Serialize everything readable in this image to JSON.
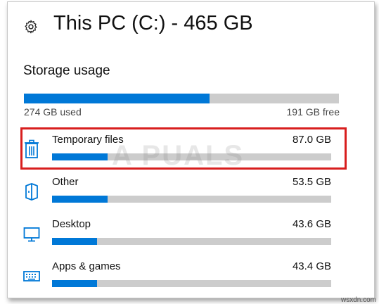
{
  "header": {
    "icon": "gear-icon",
    "title": "This PC (C:) - 465 GB"
  },
  "storage": {
    "section_title": "Storage usage",
    "used_text": "274 GB used",
    "free_text": "191 GB free",
    "used_fraction": 0.589
  },
  "items": [
    {
      "icon": "trash-icon",
      "label": "Temporary files",
      "size": "87.0 GB",
      "fill_fraction": 0.2
    },
    {
      "icon": "folder-icon",
      "label": "Other",
      "size": "53.5 GB",
      "fill_fraction": 0.2
    },
    {
      "icon": "monitor-icon",
      "label": "Desktop",
      "size": "43.6 GB",
      "fill_fraction": 0.16
    },
    {
      "icon": "keyboard-icon",
      "label": "Apps & games",
      "size": "43.4 GB",
      "fill_fraction": 0.16
    }
  ],
  "colors": {
    "accent": "#0078d7",
    "track": "#cccccc",
    "highlight": "#d81e1e"
  },
  "watermark": "A PUALS",
  "credit": "wsxdn.com"
}
